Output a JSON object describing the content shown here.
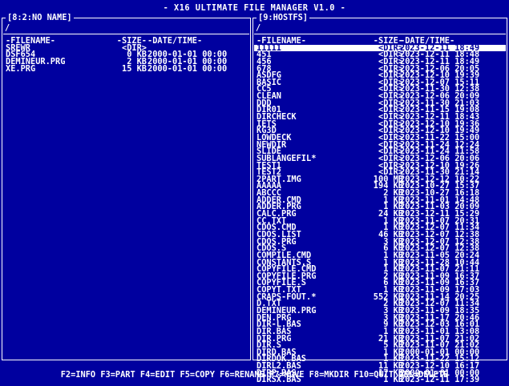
{
  "app": {
    "title": "- X16 ULTIMATE FILE MANAGER V1.0 -"
  },
  "left_panel": {
    "title": "[8:2:NO NAME]",
    "path": "/",
    "headers": {
      "name": "-FILENAME-",
      "size": "-SIZE-",
      "date": "-DATE/TIME-"
    },
    "files": [
      {
        "name": "SREWR",
        "size": "<DIR>",
        "date": ""
      },
      {
        "name": "DSF654",
        "size": "0 KB",
        "date": "2000-01-01 00:00"
      },
      {
        "name": "DEMINEUR.PRG",
        "size": "2 KB",
        "date": "2000-01-01 00:00"
      },
      {
        "name": "XE.PRG",
        "size": "15 KB",
        "date": "2000-01-01 00:00"
      }
    ]
  },
  "right_panel": {
    "title": "[9:HOSTFS]",
    "path": "/",
    "headers": {
      "name": "-FILENAME-",
      "size": "-SIZE-",
      "date": "-DATE/TIME-"
    },
    "selected_index": 0,
    "files": [
      {
        "name": "11111",
        "size": "<DIR>",
        "date": "2023-12-11 18:49"
      },
      {
        "name": "451",
        "size": "<DIR>",
        "date": "2023-12-11 18:48"
      },
      {
        "name": "456",
        "size": "<DIR>",
        "date": "2023-12-11 18:49"
      },
      {
        "name": "678",
        "size": "<DIR>",
        "date": "2023-12-06 20:05"
      },
      {
        "name": "ASDFG",
        "size": "<DIR>",
        "date": "2023-12-10 19:39"
      },
      {
        "name": "BASIC",
        "size": "<DIR>",
        "date": "2023-12-07 15:11"
      },
      {
        "name": "CC5",
        "size": "<DIR>",
        "date": "2023-11-30 12:38"
      },
      {
        "name": "CLEAN",
        "size": "<DIR>",
        "date": "2023-12-06 20:09"
      },
      {
        "name": "DDD",
        "size": "<DIR>",
        "date": "2023-11-30 21:03"
      },
      {
        "name": "DIR01",
        "size": "<DIR>",
        "date": "2023-11-15 19:08"
      },
      {
        "name": "DIRCHECK",
        "size": "<DIR>",
        "date": "2023-12-11 18:43"
      },
      {
        "name": "IETS",
        "size": "<DIR>",
        "date": "2023-12-10 19:36"
      },
      {
        "name": "KG3D",
        "size": "<DIR>",
        "date": "2023-12-10 19:49"
      },
      {
        "name": "LOWDECK",
        "size": "<DIR>",
        "date": "2023-11-22 15:00"
      },
      {
        "name": "NEWDIR",
        "size": "<DIR>",
        "date": "2023-11-24 12:24"
      },
      {
        "name": "SLIDE",
        "size": "<DIR>",
        "date": "2023-11-24 11:58"
      },
      {
        "name": "SUBLANGEFIL*",
        "size": "<DIR>",
        "date": "2023-12-06 20:06"
      },
      {
        "name": "TEST1",
        "size": "<DIR>",
        "date": "2023-12-10 19:26"
      },
      {
        "name": "TEST2",
        "size": "<DIR>",
        "date": "2023-11-30 21:14"
      },
      {
        "name": "2PART.IMG",
        "size": "100 MB",
        "date": "2023-12-12 10:22"
      },
      {
        "name": "AAAAA",
        "size": "194 KB",
        "date": "2023-10-27 15:37"
      },
      {
        "name": "ABCCC",
        "size": "2 KB",
        "date": "2023-10-27 16:18"
      },
      {
        "name": "ADDER.CMD",
        "size": "1 KB",
        "date": "2023-11-01 14:48"
      },
      {
        "name": "ADDER.PRG",
        "size": "1 KB",
        "date": "2023-11-03 20:09"
      },
      {
        "name": "CALC.PRG",
        "size": "24 KB",
        "date": "2023-12-11 15:29"
      },
      {
        "name": "CC.TXT",
        "size": "1 KB",
        "date": "2023-11-07 20:31"
      },
      {
        "name": "CDOS.CMD",
        "size": "1 KB",
        "date": "2023-12-07 11:34"
      },
      {
        "name": "CDOS.LIST",
        "size": "46 KB",
        "date": "2023-12-07 12:38"
      },
      {
        "name": "CDOS.PRG",
        "size": "3 KB",
        "date": "2023-12-07 12:38"
      },
      {
        "name": "CDOS.S",
        "size": "6 KB",
        "date": "2023-12-07 12:38"
      },
      {
        "name": "COMPILE.CMD",
        "size": "1 KB",
        "date": "2023-11-05 20:24"
      },
      {
        "name": "CONSTANTS.S",
        "size": "1 KB",
        "date": "2023-11-28 10:44"
      },
      {
        "name": "COPYFILE.CMD",
        "size": "1 KB",
        "date": "2023-11-07 21:11"
      },
      {
        "name": "COPYFILE.PRG",
        "size": "2 KB",
        "date": "2023-11-09 16:37"
      },
      {
        "name": "COPYFILE.S",
        "size": "6 KB",
        "date": "2023-11-09 16:37"
      },
      {
        "name": "COPYT.TXT",
        "size": "1 KB",
        "date": "2023-11-09 17:03"
      },
      {
        "name": "CRAPS-FOUT.*",
        "size": "552 KB",
        "date": "2023-11-14 20:25"
      },
      {
        "name": "D.TXT",
        "size": "2 KB",
        "date": "2023-12-07 11:34"
      },
      {
        "name": "DEMINEUR.PRG",
        "size": "3 KB",
        "date": "2023-11-09 18:35"
      },
      {
        "name": "DEN.PRG",
        "size": "3 KB",
        "date": "2023-11-17 20:46"
      },
      {
        "name": "DIR-L.BAS",
        "size": "9 KB",
        "date": "2023-12-03 16:01"
      },
      {
        "name": "DIR.BAS",
        "size": "1 KB",
        "date": "2023-11-01 13:08"
      },
      {
        "name": "DIR.PRG",
        "size": "21 KB",
        "date": "2023-11-07 21:02"
      },
      {
        "name": "DIR.S",
        "size": "5 KB",
        "date": "2023-11-07 21:02"
      },
      {
        "name": "DIRD.BAS",
        "size": "1 KB",
        "date": "2000-01-01 00:00"
      },
      {
        "name": "DIRDOK.BAS",
        "size": "1 KB",
        "date": "2023-11-22 15:12"
      },
      {
        "name": "DIRL2.BAS",
        "size": "11 KB",
        "date": "2023-12-10 16:17"
      },
      {
        "name": "DIRP.BAS",
        "size": "17 KB",
        "date": "2000-01-01 00:00"
      },
      {
        "name": "DIRSX.BAS",
        "size": "1 KB",
        "date": "2023-12-11 17:39"
      }
    ]
  },
  "footer": {
    "keys": "F2=INFO F3=PART F4=EDIT F5=COPY F6=RENAME F7=MOVE F8=MKDIR F10=QUIT DEL=DELETE"
  },
  "colors": {
    "background": "#00009f",
    "foreground": "#ffffff"
  }
}
